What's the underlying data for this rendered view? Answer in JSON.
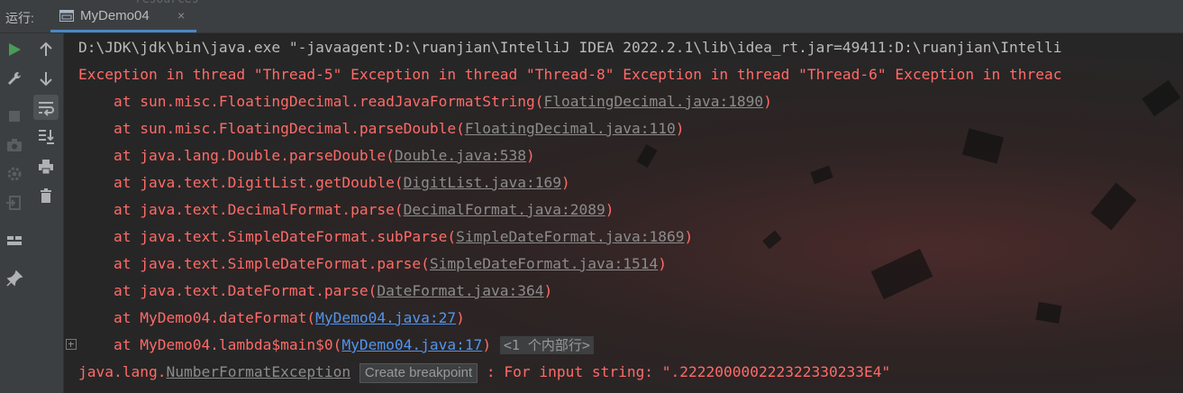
{
  "run_panel": {
    "label": "运行:"
  },
  "tabs": [
    {
      "label": "MyDemo04",
      "close": "×"
    }
  ],
  "top_strip": {
    "resources_label": "resources"
  },
  "console": {
    "command_line": "D:\\JDK\\jdk\\bin\\java.exe \"-javaagent:D:\\ruanjian\\IntelliJ IDEA 2022.2.1\\lib\\idea_rt.jar=49411:D:\\ruanjian\\Intelli",
    "exception_header": "Exception in thread \"Thread-5\" Exception in thread \"Thread-8\" Exception in thread \"Thread-6\" Exception in threac",
    "stack": [
      {
        "prefix": "    at sun.misc.FloatingDecimal.readJavaFormatString(",
        "link": "FloatingDecimal.java:1890",
        "suffix": ")",
        "link_type": "gray"
      },
      {
        "prefix": "    at sun.misc.FloatingDecimal.parseDouble(",
        "link": "FloatingDecimal.java:110",
        "suffix": ")",
        "link_type": "gray"
      },
      {
        "prefix": "    at java.lang.Double.parseDouble(",
        "link": "Double.java:538",
        "suffix": ")",
        "link_type": "gray"
      },
      {
        "prefix": "    at java.text.DigitList.getDouble(",
        "link": "DigitList.java:169",
        "suffix": ")",
        "link_type": "gray"
      },
      {
        "prefix": "    at java.text.DecimalFormat.parse(",
        "link": "DecimalFormat.java:2089",
        "suffix": ")",
        "link_type": "gray"
      },
      {
        "prefix": "    at java.text.SimpleDateFormat.subParse(",
        "link": "SimpleDateFormat.java:1869",
        "suffix": ")",
        "link_type": "gray"
      },
      {
        "prefix": "    at java.text.SimpleDateFormat.parse(",
        "link": "SimpleDateFormat.java:1514",
        "suffix": ")",
        "link_type": "gray"
      },
      {
        "prefix": "    at java.text.DateFormat.parse(",
        "link": "DateFormat.java:364",
        "suffix": ")",
        "link_type": "gray"
      },
      {
        "prefix": "    at MyDemo04.dateFormat(",
        "link": "MyDemo04.java:27",
        "suffix": ")",
        "link_type": "blue"
      },
      {
        "prefix": "    at MyDemo04.lambda$main$0(",
        "link": "MyDemo04.java:17",
        "suffix": ")",
        "link_type": "blue",
        "hint": "<1 个内部行>"
      }
    ],
    "exception_line": {
      "prefix": "java.lang.",
      "link": "NumberFormatException",
      "tooltip": "Create breakpoint",
      "message": " : For input string: \".222200000222322330233E4\""
    }
  },
  "toolbar_icons": {
    "left": [
      "run-icon",
      "wrench-icon",
      "stop-icon",
      "camera-icon",
      "settings-icon",
      "exit-icon",
      "layout-icon",
      "pin-icon"
    ],
    "right": [
      "up-arrow-icon",
      "down-arrow-icon",
      "soft-wrap-icon",
      "scroll-to-end-icon",
      "print-icon",
      "trash-icon"
    ]
  },
  "colors": {
    "error_text": "#ff6b68",
    "link_gray": "#8c8c8c",
    "link_blue": "#5394ec",
    "tab_underline": "#4a88c7",
    "run_green": "#499c54"
  }
}
